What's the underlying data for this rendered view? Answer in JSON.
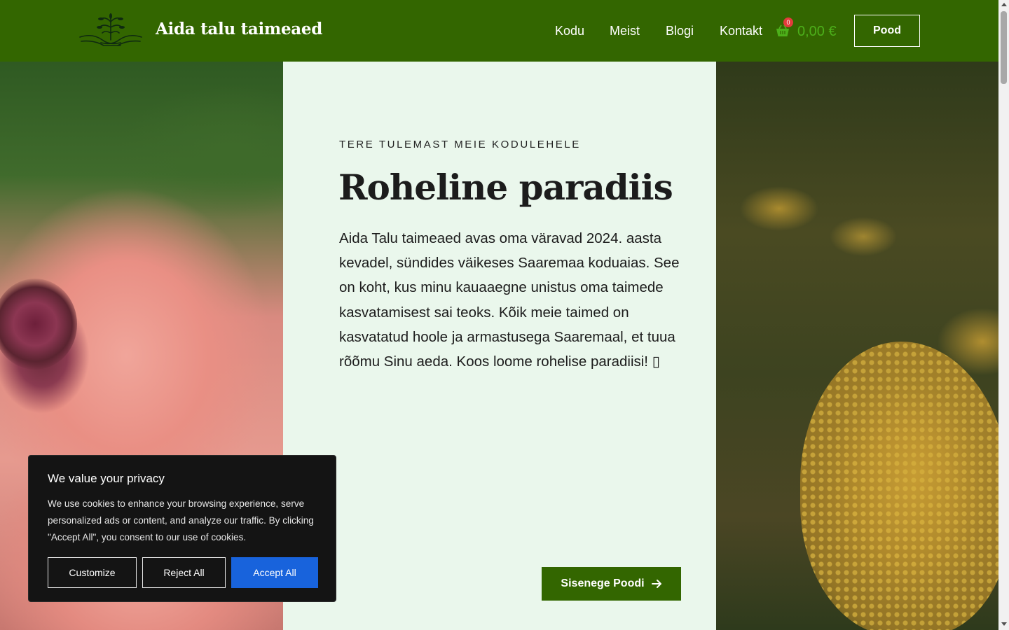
{
  "header": {
    "site_title": "Aida talu taimeaed",
    "nav": [
      {
        "label": "Kodu"
      },
      {
        "label": "Meist"
      },
      {
        "label": "Blogi"
      },
      {
        "label": "Kontakt"
      }
    ],
    "cart": {
      "count": "0",
      "total": "0,00 €"
    },
    "shop_button": "Pood"
  },
  "hero": {
    "eyebrow": "TERE TULEMAST MEIE KODULEHELE",
    "title": "Roheline paradiis",
    "text": "Aida Talu taimeaed avas oma väravad 2024. aasta kevadel, sündides väikeses Saaremaa koduaias. See on koht, kus minu kauaaegne unistus oma taimede kasvatamisest sai teoks. Kõik meie taimed on kasvatatud hoole ja armastusega Saaremaal, et tuua rõõmu Sinu aeda. Koos loome rohelise paradiisi! ▯",
    "cta": "Sisenege Poodi"
  },
  "cookie": {
    "title": "We value your privacy",
    "text": "We use cookies to enhance your browsing experience, serve personalized ads or content, and analyze our traffic. By clicking \"Accept All\", you consent to our use of cookies.",
    "customize": "Customize",
    "reject": "Reject All",
    "accept": "Accept All"
  },
  "colors": {
    "header_bg": "#336600",
    "hero_panel_bg": "#eaf7ec",
    "cart_total": "#4caf1a",
    "accept_button": "#1863dc"
  },
  "icons": {
    "logo": "hands-holding-plant-logo",
    "cart": "shopping-basket-icon",
    "cta_arrow": "arrow-right-icon"
  }
}
